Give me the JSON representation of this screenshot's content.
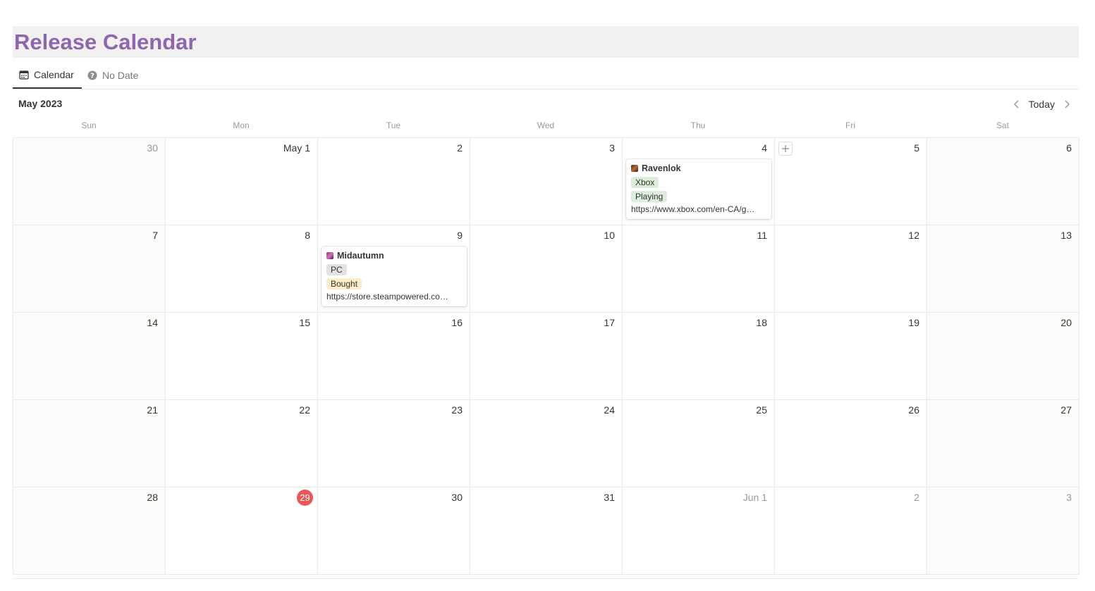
{
  "page": {
    "title": "Release Calendar"
  },
  "tabs": [
    {
      "label": "Calendar",
      "icon": "calendar-icon",
      "active": true
    },
    {
      "label": "No Date",
      "icon": "question-circle-icon",
      "active": false
    }
  ],
  "calendar": {
    "month_label": "May 2023",
    "today_label": "Today",
    "weekdays": [
      "Sun",
      "Mon",
      "Tue",
      "Wed",
      "Thu",
      "Fri",
      "Sat"
    ],
    "weeks": [
      [
        "30",
        "May 1",
        "2",
        "3",
        "4",
        "5",
        "6"
      ],
      [
        "7",
        "8",
        "9",
        "10",
        "11",
        "12",
        "13"
      ],
      [
        "14",
        "15",
        "16",
        "17",
        "18",
        "19",
        "20"
      ],
      [
        "21",
        "22",
        "23",
        "24",
        "25",
        "26",
        "27"
      ],
      [
        "28",
        "29",
        "30",
        "31",
        "Jun 1",
        "2",
        "3"
      ]
    ],
    "today_badge": "29",
    "today_color": "#eb5757"
  },
  "events": {
    "ravenlok": {
      "title": "Ravenlok",
      "platform": "Xbox",
      "status": "Playing",
      "url": "https://www.xbox.com/en-CA/g…"
    },
    "midautumn": {
      "title": "Midautumn",
      "platform": "PC",
      "status": "Bought",
      "url": "https://store.steampowered.co…"
    }
  },
  "colors": {
    "title": "#9065b0",
    "tag_xbox": "#dbeddb",
    "tag_playing": "#dbeddb",
    "tag_pc": "#e3e2e0",
    "tag_bought": "#fdecc8"
  }
}
